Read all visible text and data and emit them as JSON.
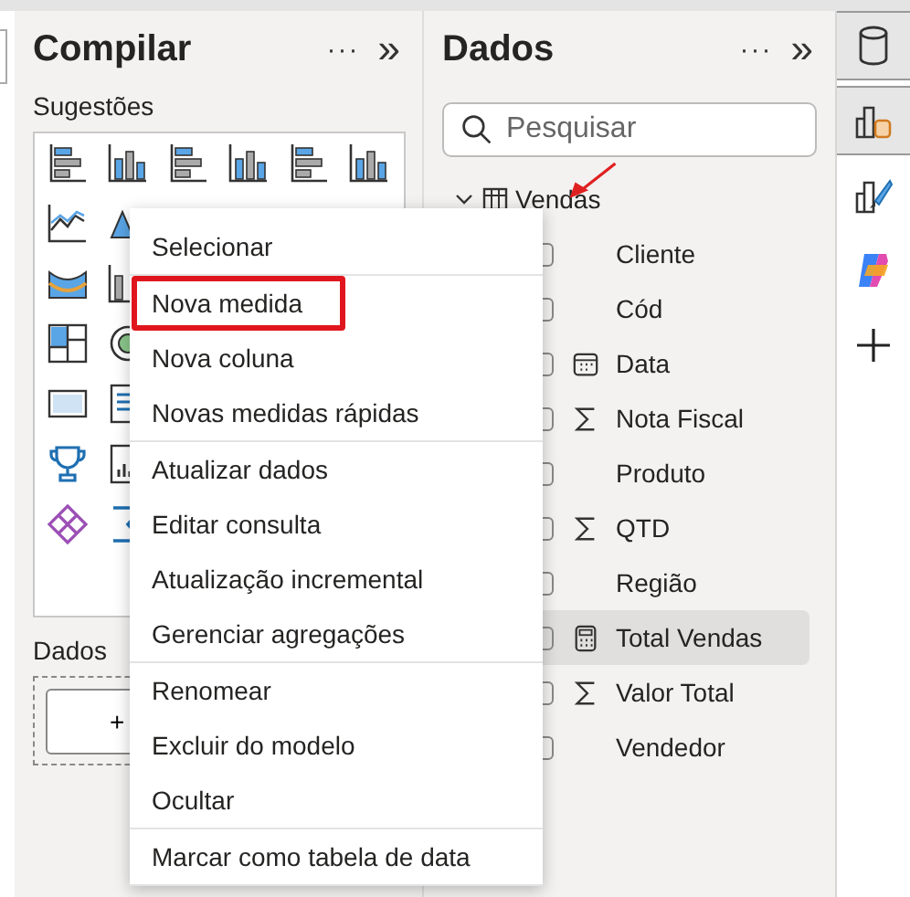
{
  "build_pane": {
    "title": "Compilar",
    "more": "···",
    "collapse": "»",
    "suggestions_label": "Sugestões",
    "data_label": "Dados",
    "add_button": "+"
  },
  "data_pane": {
    "title": "Dados",
    "more": "···",
    "collapse": "»",
    "search": {
      "placeholder": "Pesquisar"
    },
    "table": {
      "name": "Vendas",
      "expanded": true,
      "fields": [
        {
          "name": "Cliente",
          "kind": "text",
          "selected": false
        },
        {
          "name": "Cód",
          "kind": "text",
          "selected": false
        },
        {
          "name": "Data",
          "kind": "date",
          "selected": false
        },
        {
          "name": "Nota Fiscal",
          "kind": "sum",
          "selected": false
        },
        {
          "name": "Produto",
          "kind": "text",
          "selected": false
        },
        {
          "name": "QTD",
          "kind": "sum",
          "selected": false
        },
        {
          "name": "Região",
          "kind": "text",
          "selected": false
        },
        {
          "name": "Total Vendas",
          "kind": "measure",
          "selected": true
        },
        {
          "name": "Valor Total",
          "kind": "sum",
          "selected": false
        },
        {
          "name": "Vendedor",
          "kind": "text",
          "selected": false
        }
      ]
    }
  },
  "context_menu": {
    "groups": [
      [
        {
          "label": "Selecionar",
          "highlighted": false
        }
      ],
      [
        {
          "label": "Nova medida",
          "highlighted": true
        },
        {
          "label": "Nova coluna",
          "highlighted": false
        },
        {
          "label": "Novas medidas rápidas",
          "highlighted": false
        }
      ],
      [
        {
          "label": "Atualizar dados",
          "highlighted": false
        },
        {
          "label": "Editar consulta",
          "highlighted": false
        },
        {
          "label": "Atualização incremental",
          "highlighted": false
        },
        {
          "label": "Gerenciar agregações",
          "highlighted": false
        }
      ],
      [
        {
          "label": "Renomear",
          "highlighted": false
        },
        {
          "label": "Excluir do modelo",
          "highlighted": false
        },
        {
          "label": "Ocultar",
          "highlighted": false
        }
      ],
      [
        {
          "label": "Marcar como tabela de data",
          "highlighted": false
        }
      ]
    ]
  },
  "rail": [
    {
      "kind": "data",
      "selected": true
    },
    {
      "kind": "model",
      "selected": true
    },
    {
      "kind": "format",
      "selected": false
    },
    {
      "kind": "copilot",
      "selected": false
    },
    {
      "kind": "add",
      "selected": false
    }
  ]
}
